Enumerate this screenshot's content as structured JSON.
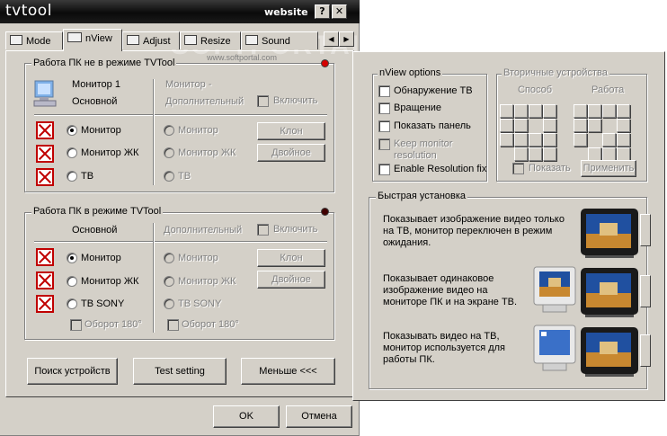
{
  "window": {
    "title": "tvtool",
    "website": "website",
    "help_btn": "?",
    "close_btn": "✕"
  },
  "tabs": [
    {
      "label": "Mode"
    },
    {
      "label": "nView"
    },
    {
      "label": "Adjust"
    },
    {
      "label": "Resize"
    },
    {
      "label": "Sound"
    }
  ],
  "watermark": "SOFTPORTAL",
  "watermark_url": "www.softportal.com",
  "group1": {
    "title": "Работа ПК не в режиме TVTool",
    "indicator_color": "#d40000",
    "primary_label_1": "Монитор 1",
    "primary_label_2": "Основной",
    "secondary_label_1": "Монитор -",
    "secondary_label_2": "Дополнительный",
    "enable_label": "Включить",
    "radios_primary": [
      "Монитор",
      "Монитор ЖК",
      "ТВ"
    ],
    "radios_secondary": [
      "Монитор",
      "Монитор ЖК",
      "ТВ"
    ],
    "clone_btn": "Клон",
    "dual_btn": "Двойное"
  },
  "group2": {
    "title": "Работа ПК в режиме TVTool",
    "indicator_color": "#400000",
    "primary_header": "Основной",
    "secondary_header": "Дополнительный",
    "enable_label": "Включить",
    "radios_primary": [
      "Монитор",
      "Монитор ЖК",
      "ТВ SONY"
    ],
    "radios_secondary": [
      "Монитор",
      "Монитор ЖК",
      "ТВ SONY"
    ],
    "rotate_primary": "Оборот 180°",
    "rotate_secondary": "Оборот 180°",
    "clone_btn": "Клон",
    "dual_btn": "Двойное"
  },
  "bottom_buttons": {
    "search": "Поиск устройств",
    "test": "Test setting",
    "less": "Меньше <<<"
  },
  "dialog": {
    "ok": "OK",
    "cancel": "Отмена"
  },
  "nview_options": {
    "title": "nView options",
    "items": [
      {
        "label": "Обнаружение ТВ",
        "enabled": true
      },
      {
        "label": "Вращение",
        "enabled": true
      },
      {
        "label": "Показать панель",
        "enabled": true
      },
      {
        "label": "Keep monitor resolution",
        "label_1": "Keep monitor",
        "label_2": "resolution",
        "enabled": false
      },
      {
        "label": "Enable Resolution fix",
        "enabled": true
      }
    ]
  },
  "secondary_devices": {
    "title": "Вторичные устройства",
    "col_method": "Способ",
    "col_work": "Работа",
    "show_label": "Показать",
    "apply_btn": "Применить"
  },
  "quick_setup": {
    "title": "Быстрая установка",
    "items": [
      {
        "text_1": "Показывает изображение видео только",
        "text_2": "на ТВ, монитор переключен в режим",
        "text_3": "ожидания."
      },
      {
        "text_1": "Показывает одинаковое",
        "text_2": "изображение видео на",
        "text_3": "мониторе ПК и на экране ТВ."
      },
      {
        "text_1": "Показывать видео на ТВ,",
        "text_2": "монитор используется для",
        "text_3": "работы ПК."
      }
    ]
  }
}
